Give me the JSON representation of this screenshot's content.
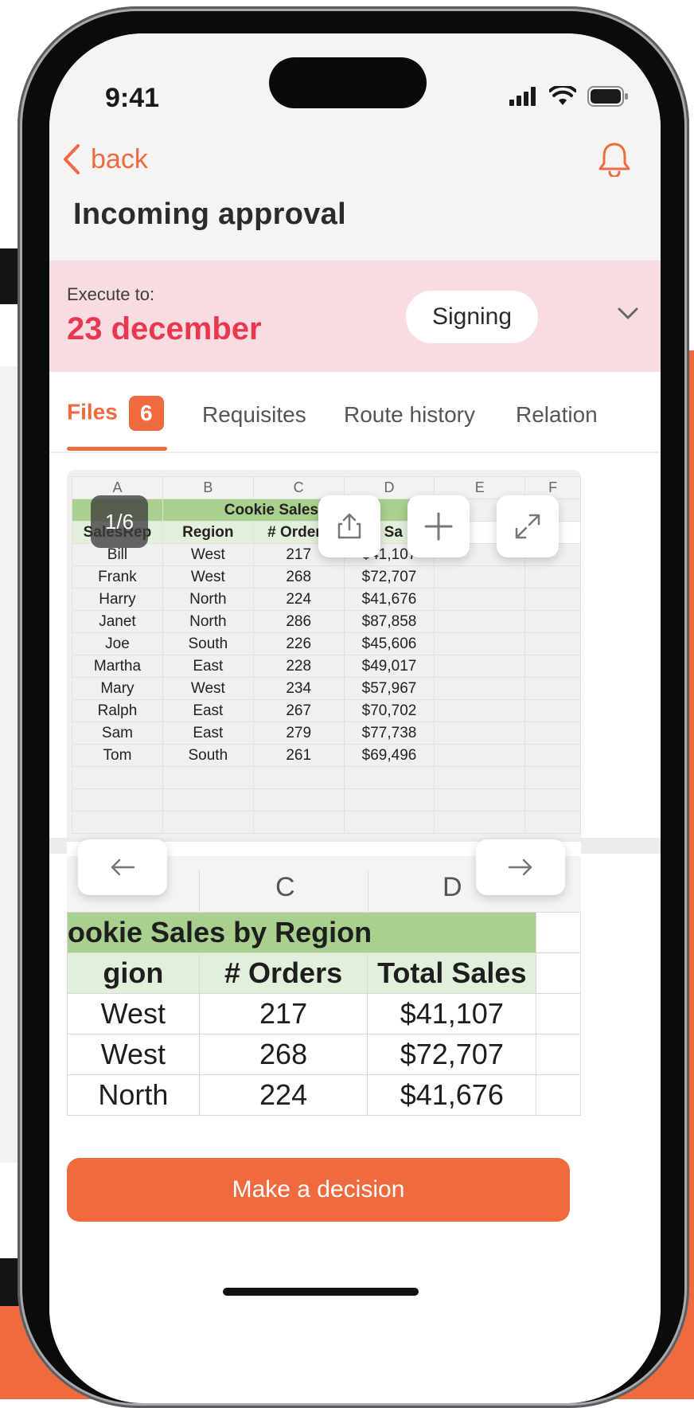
{
  "status_bar": {
    "time": "9:41"
  },
  "header": {
    "back_label": "back",
    "title": "Incoming approval"
  },
  "execute": {
    "label": "Execute to:",
    "date": "23 december",
    "status": "Signing"
  },
  "tabs": [
    {
      "label": "Files",
      "badge": "6",
      "active": true
    },
    {
      "label": "Requisites"
    },
    {
      "label": "Route history"
    },
    {
      "label": "Relation"
    }
  ],
  "preview": {
    "pager": "1/6",
    "columns": [
      "A",
      "B",
      "C",
      "D",
      "E",
      "F"
    ],
    "sheet_title": "Cookie Sales by Reg",
    "col_headers": [
      "SalesRep",
      "Region",
      "# Orders",
      "l Sa"
    ],
    "rows": [
      [
        "Bill",
        "West",
        "217",
        "$41,107"
      ],
      [
        "Frank",
        "West",
        "268",
        "$72,707"
      ],
      [
        "Harry",
        "North",
        "224",
        "$41,676"
      ],
      [
        "Janet",
        "North",
        "286",
        "$87,858"
      ],
      [
        "Joe",
        "South",
        "226",
        "$45,606"
      ],
      [
        "Martha",
        "East",
        "228",
        "$49,017"
      ],
      [
        "Mary",
        "West",
        "234",
        "$57,967"
      ],
      [
        "Ralph",
        "East",
        "267",
        "$70,702"
      ],
      [
        "Sam",
        "East",
        "279",
        "$77,738"
      ],
      [
        "Tom",
        "South",
        "261",
        "$69,496"
      ]
    ]
  },
  "zoom": {
    "columns": [
      "C",
      "D"
    ],
    "title": "ookie Sales by Region",
    "headers": [
      "gion",
      "# Orders",
      "Total Sales"
    ],
    "rows": [
      [
        "West",
        "217",
        "$41,107"
      ],
      [
        "West",
        "268",
        "$72,707"
      ],
      [
        "North",
        "224",
        "$41,676"
      ]
    ]
  },
  "footer": {
    "decision_label": "Make a decision"
  },
  "colors": {
    "accent": "#ef6a3f",
    "date_red": "#e8384f",
    "band_pink": "#f9dce1",
    "sheet_green": "#a9d08e"
  }
}
